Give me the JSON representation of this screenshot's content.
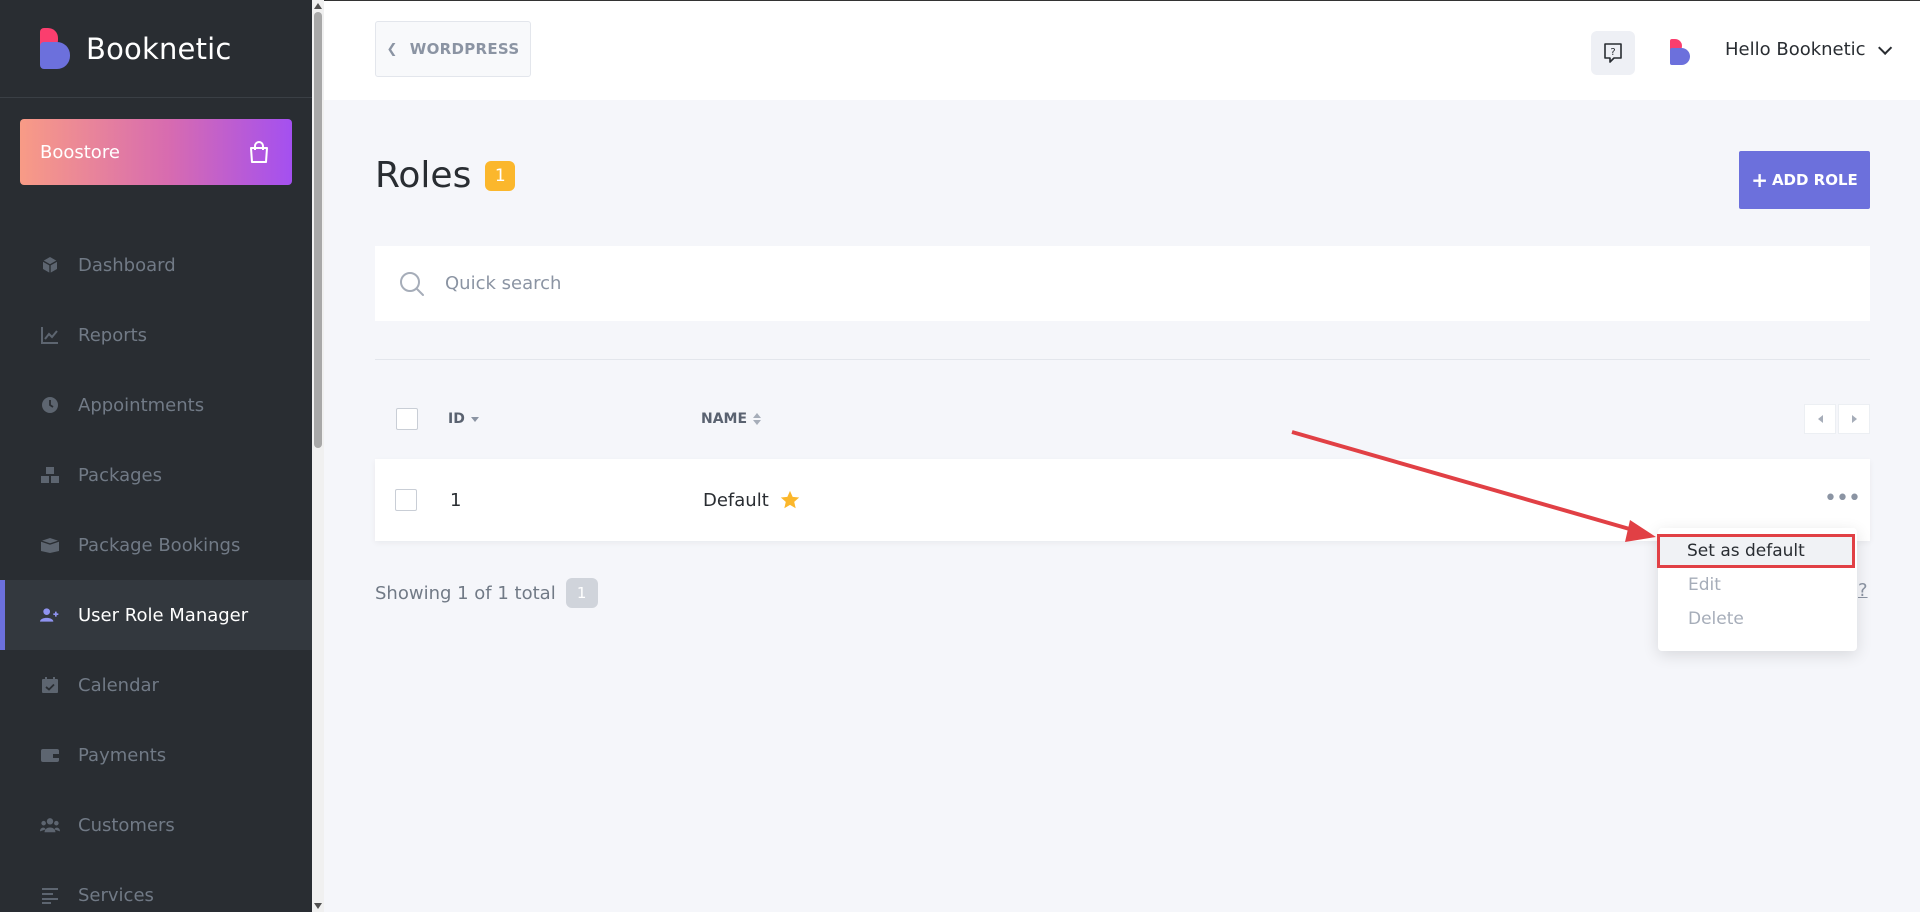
{
  "brand": {
    "name": "Booknetic"
  },
  "boostore": {
    "label": "Boostore"
  },
  "sidebar": {
    "items": [
      {
        "label": "Dashboard",
        "icon": "cube-icon",
        "active": false
      },
      {
        "label": "Reports",
        "icon": "chart-line-icon",
        "active": false
      },
      {
        "label": "Appointments",
        "icon": "clock-icon",
        "active": false
      },
      {
        "label": "Packages",
        "icon": "boxes-icon",
        "active": false
      },
      {
        "label": "Package Bookings",
        "icon": "box-open-icon",
        "active": false
      },
      {
        "label": "User Role Manager",
        "icon": "user-plus-icon",
        "active": true
      },
      {
        "label": "Calendar",
        "icon": "calendar-check-icon",
        "active": false
      },
      {
        "label": "Payments",
        "icon": "wallet-icon",
        "active": false
      },
      {
        "label": "Customers",
        "icon": "users-icon",
        "active": false
      },
      {
        "label": "Services",
        "icon": "list-icon",
        "active": false
      }
    ]
  },
  "topbar": {
    "back_label": "WORDPRESS",
    "user_greeting": "Hello Booknetic"
  },
  "page": {
    "title": "Roles",
    "count": "1",
    "add_button": "ADD ROLE"
  },
  "search": {
    "placeholder": "Quick search"
  },
  "table": {
    "columns": [
      "ID",
      "NAME"
    ],
    "rows": [
      {
        "id": "1",
        "name": "Default",
        "is_default": true
      }
    ],
    "footer_text": "Showing 1 of 1 total",
    "footer_count": "1",
    "footer_link": "?"
  },
  "row_menu": {
    "items": [
      "Set as default",
      "Edit",
      "Delete"
    ]
  },
  "colors": {
    "sidebar_bg": "#292d32",
    "accent": "#6c70dc",
    "brand_pink": "#fb3e6e",
    "badge": "#fbb72c",
    "annotation": "#e14045"
  }
}
